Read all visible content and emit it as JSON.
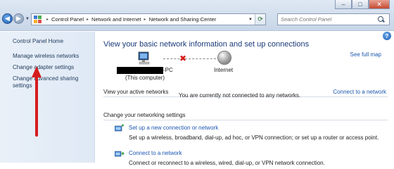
{
  "window": {
    "buttons": {
      "minimize": "–",
      "maximize": "□",
      "close": "✕"
    }
  },
  "address_bar": {
    "crumbs": [
      "Control Panel",
      "Network and Internet",
      "Network and Sharing Center"
    ],
    "separator": "▸"
  },
  "search": {
    "placeholder": "Search Control Panel"
  },
  "sidebar": {
    "home": "Control Panel Home",
    "items": [
      {
        "label": "Manage wireless networks"
      },
      {
        "label": "Change adapter settings"
      },
      {
        "label": "Change advanced sharing settings"
      }
    ]
  },
  "main": {
    "help": "?",
    "heading": "View your basic network information and set up connections",
    "see_full_map": "See full map",
    "map": {
      "computer_suffix": "-PC",
      "computer_sub": "(This computer)",
      "internet_label": "Internet"
    },
    "active_networks": {
      "label": "View your active networks",
      "status": "You are currently not connected to any networks.",
      "connect_link": "Connect to a network"
    },
    "settings": {
      "label": "Change your networking settings",
      "tasks": [
        {
          "title": "Set up a new connection or network",
          "description": "Set up a wireless, broadband, dial-up, ad hoc, or VPN connection; or set up a router or access point."
        },
        {
          "title": "Connect to a network",
          "description": "Connect or reconnect to a wireless, wired, dial-up, or VPN network connection."
        }
      ]
    }
  },
  "colors": {
    "link": "#1a56b0",
    "heading": "#1c3a7a",
    "sidebar_bg": "#e5edf7",
    "annotation_arrow": "#d51c1c"
  }
}
